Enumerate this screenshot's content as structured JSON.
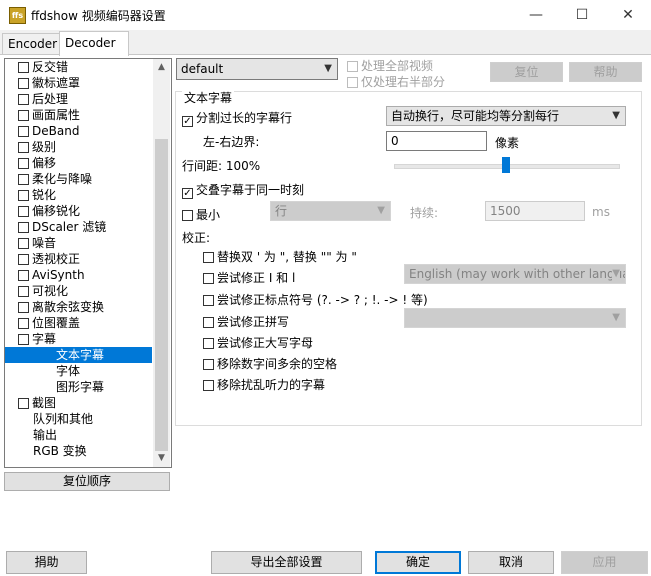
{
  "window": {
    "title": "ffdshow 视频编码器设置",
    "icon_text": "ffs",
    "minimize": "—",
    "maximize": "☐",
    "close": "✕"
  },
  "tabs": [
    "Encoder",
    "Decoder"
  ],
  "tree": {
    "items": [
      {
        "label": "反交错",
        "cb": true
      },
      {
        "label": "徽标遮罩",
        "cb": true
      },
      {
        "label": "后处理",
        "cb": true
      },
      {
        "label": "画面属性",
        "cb": true
      },
      {
        "label": "DeBand",
        "cb": true
      },
      {
        "label": "级别",
        "cb": true
      },
      {
        "label": "偏移",
        "cb": true
      },
      {
        "label": "柔化与降噪",
        "cb": true
      },
      {
        "label": "锐化",
        "cb": true
      },
      {
        "label": "偏移锐化",
        "cb": true
      },
      {
        "label": "DScaler 滤镜",
        "cb": true
      },
      {
        "label": "噪音",
        "cb": true
      },
      {
        "label": "透视校正",
        "cb": true
      },
      {
        "label": "AviSynth",
        "cb": true
      },
      {
        "label": "可视化",
        "cb": true
      },
      {
        "label": "离散余弦变换",
        "cb": true
      },
      {
        "label": "位图覆盖",
        "cb": true
      },
      {
        "label": "字幕",
        "cb": true
      },
      {
        "label": "文本字幕",
        "cb": false,
        "child": true,
        "selected": true
      },
      {
        "label": "字体",
        "cb": false,
        "child": true
      },
      {
        "label": "图形字幕",
        "cb": false,
        "child": true
      },
      {
        "label": "截图",
        "cb": true
      },
      {
        "label": "队列和其他",
        "cb": false
      },
      {
        "label": "输出",
        "cb": false
      },
      {
        "label": "RGB 变换",
        "cb": false
      }
    ]
  },
  "reset_order_label": "复位顺序",
  "preset": {
    "value": "default"
  },
  "process_all": "处理全部视频",
  "process_right_half": "仅处理右半部分",
  "reset_label": "复位",
  "help_label": "帮助",
  "group": {
    "title": "文本字幕",
    "split_long": "分割过长的字幕行",
    "split_mode": "自动换行，尽可能均等分割每行",
    "margin_label": "左-右边界:",
    "margin_value": "0",
    "margin_unit": "像素",
    "line_spacing_label": "行间距: 100%",
    "line_spacing_percent": 100,
    "overlap": "交叠字幕于同一时刻",
    "min_label": "最小",
    "min_unit": "行",
    "duration_label": "持续:",
    "duration_value": "1500",
    "duration_unit": "ms",
    "correction_label": "校正:",
    "replace_quotes": "替换双 ' 为 \", 替换 \"\" 为 \"",
    "fix_il": "尝试修正 I 和 l",
    "fix_il_lang": "English (may work with other langua",
    "fix_punct": "尝试修正标点符号 (?. -> ? ; !. -> ! 等)",
    "fix_spelling": "尝试修正拼写",
    "fix_caps": "尝试修正大写字母",
    "remove_digit_spaces": "移除数字间多余的空格",
    "remove_hearing": "移除扰乱听力的字幕"
  },
  "bottom": {
    "donate": "捐助",
    "export": "导出全部设置",
    "ok": "确定",
    "cancel": "取消",
    "apply": "应用"
  }
}
